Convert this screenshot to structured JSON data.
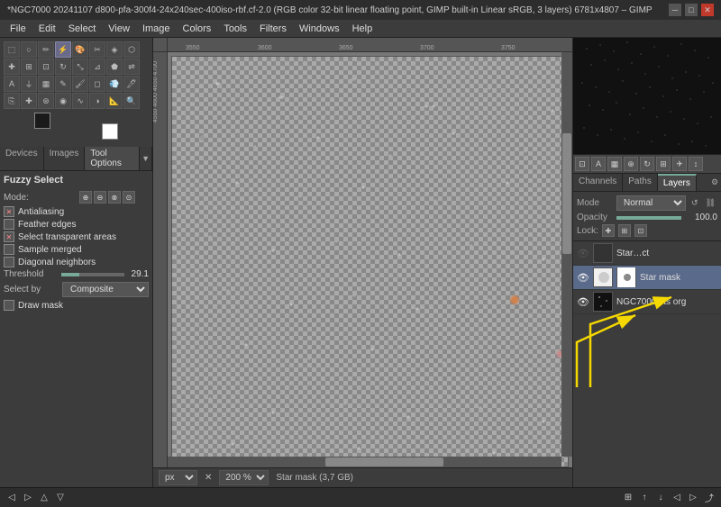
{
  "titlebar": {
    "title": "*NGC7000 20241107 d800-pfa-300f4-24x240sec-400iso-rbf.cf-2.0 (RGB color 32-bit linear floating point, GIMP built-in Linear sRGB, 3 layers) 6781x4807 – GIMP",
    "short_title": "*NGC7000 20241107 d800-pfa-300f4-24x240sec-400iso-rbf.cf-2.0 (RGB color 32-bit linear floating point, GIMP built-in Linear sRGB, 3 layers) 6781x4807 – GIMP"
  },
  "menu": {
    "items": [
      "File",
      "Edit",
      "Select",
      "View",
      "Image",
      "Colors",
      "Tools",
      "Filters",
      "Windows",
      "Help"
    ]
  },
  "left_panel": {
    "tabs": [
      "Devices",
      "Images",
      "Tool Options"
    ],
    "tool_options": {
      "title": "Fuzzy Select",
      "mode_label": "Mode:",
      "antialiasing_label": "Antialiasing",
      "feather_edges_label": "Feather edges",
      "select_transparent_label": "Select transparent areas",
      "sample_merged_label": "Sample merged",
      "diagonal_label": "Diagonal neighbors",
      "threshold_label": "Threshold",
      "threshold_value": "29.1",
      "select_by_label": "Select by",
      "select_by_value": "Composite",
      "draw_mask_label": "Draw mask"
    }
  },
  "canvas": {
    "ruler_marks_top": [
      "3550",
      "3600",
      "3650",
      "3700",
      "3750"
    ],
    "ruler_marks_left": [
      "4500",
      "4550",
      "4600",
      "4650",
      "4700"
    ],
    "status_unit": "px",
    "zoom_value": "200 %",
    "status_info": "Star mask (3,7 GB)"
  },
  "right_panel": {
    "layer_tabs": [
      "Channels",
      "Paths",
      "Layers"
    ],
    "mode_label": "Mode",
    "mode_value": "Normal",
    "opacity_label": "Opacity",
    "opacity_value": "100.0",
    "lock_label": "Lock:",
    "layers": [
      {
        "name": "Star…ct",
        "visible": false,
        "has_mask": false,
        "thumb_bg": "#444"
      },
      {
        "name": "Star mask",
        "visible": true,
        "has_mask": true,
        "thumb_bg": "#eee",
        "active": true
      },
      {
        "name": "NGC7000 fits org",
        "visible": true,
        "has_mask": false,
        "thumb_bg": "#1a1a1a"
      }
    ]
  },
  "status_bar": {
    "icons": [
      "◁",
      "▷",
      "△",
      "▽",
      "⊞"
    ]
  }
}
